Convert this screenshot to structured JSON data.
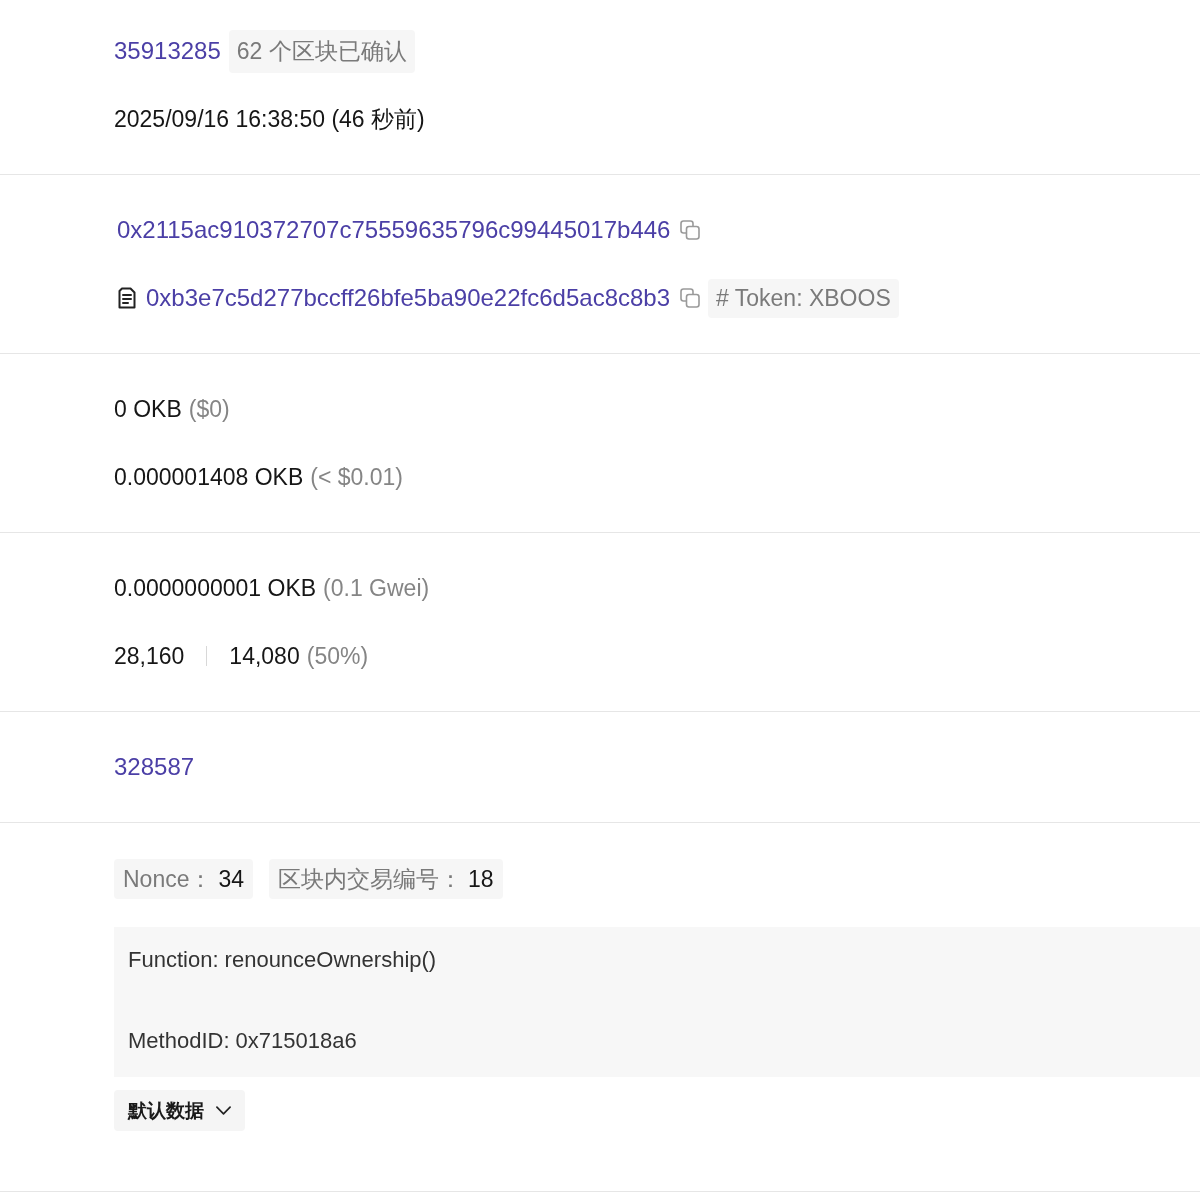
{
  "block": {
    "number": "35913285",
    "confirmations": "62 个区块已确认"
  },
  "timestamp": "2025/09/16 16:38:50 (46 秒前)",
  "from": {
    "address": "0x2115ac910372707c75559635796c99445017b446"
  },
  "to": {
    "address": "0xb3e7c5d277bccff26bfe5ba90e22fc6d5ac8c8b3",
    "tag": "# Token: XBOOS"
  },
  "value": {
    "amount": "0 OKB",
    "fiat": "($0)"
  },
  "fee": {
    "amount": "0.000001408 OKB",
    "fiat": "(< $0.01)"
  },
  "gas_price": {
    "amount": "0.0000000001 OKB",
    "gwei": "(0.1 Gwei)"
  },
  "gas": {
    "limit": "28,160",
    "used": "14,080",
    "percent": "(50%)"
  },
  "number_link": "328587",
  "attributes": [
    {
      "label": "Nonce：",
      "value": "34"
    },
    {
      "label": "区块内交易编号：",
      "value": "18"
    }
  ],
  "input_data": {
    "lines": [
      "Function: renounceOwnership()",
      "MethodID: 0x715018a6"
    ]
  },
  "format_dropdown": {
    "label": "默认数据"
  }
}
